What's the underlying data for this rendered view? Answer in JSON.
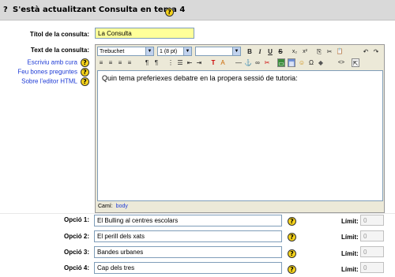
{
  "header": {
    "qmark": "?",
    "title": "S'està actualitzant Consulta en tema 4",
    "help_icon": "?"
  },
  "form": {
    "title_label": "Títol de la consulta:",
    "title_value": "La Consulta",
    "text_label": "Text de la consulta:",
    "help_links": [
      {
        "label": "Escriviu amb cura",
        "icon": "?"
      },
      {
        "label": "Feu bones preguntes",
        "icon": "?"
      },
      {
        "label": "Sobre l'editor HTML",
        "icon": "?"
      }
    ]
  },
  "editor": {
    "font_family": "Trebuchet",
    "font_size": "1 (8 pt)",
    "heading": "",
    "toolbar_row1": [
      "B",
      "I",
      "U",
      "S",
      "x₂",
      "x²",
      "⎘",
      "✂",
      "📋",
      "↶",
      "↷"
    ],
    "toolbar_row2": [
      "≡",
      "≡",
      "≡",
      "≡",
      "¶",
      "¶",
      "⋮",
      "☰",
      "⇤",
      "⇥",
      "T",
      "A",
      "—",
      "⚓",
      "∞",
      "✂",
      "▭",
      "▦",
      "☺",
      "Ω",
      "◆",
      "<>",
      "⇱"
    ],
    "content": "Quin tema preferiexes debatre en la propera sessió de tutoria:",
    "path_label": "Camí:",
    "path_value": "body"
  },
  "options": [
    {
      "label": "Opció 1:",
      "value": "El Bulling al centres escolars",
      "limit_label": "Límit:",
      "limit_value": "0"
    },
    {
      "label": "Opció 2:",
      "value": "El perill dels xats",
      "limit_label": "Límit:",
      "limit_value": "0"
    },
    {
      "label": "Opció 3:",
      "value": "Bandes urbanes",
      "limit_label": "Límit:",
      "limit_value": "0"
    },
    {
      "label": "Opció 4:",
      "value": "Cap dels tres",
      "limit_label": "Límit:",
      "limit_value": "0"
    }
  ],
  "option_help_icon": "?"
}
